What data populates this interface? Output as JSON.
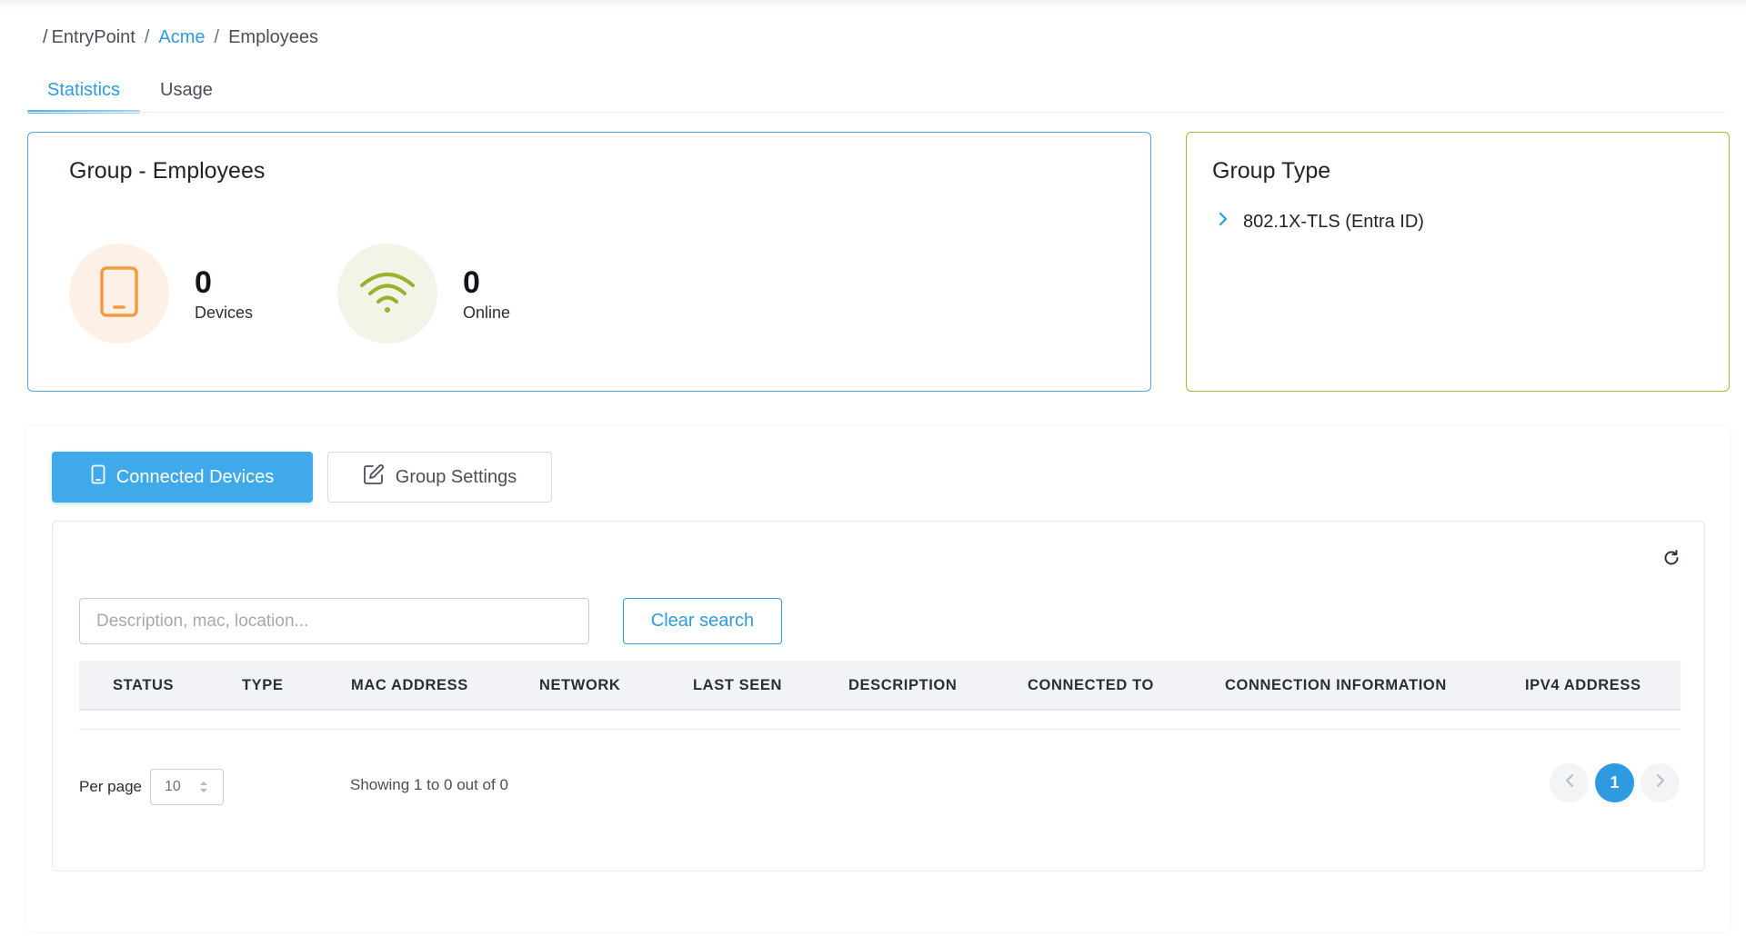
{
  "breadcrumb": {
    "root": "EntryPoint",
    "org": "Acme",
    "current": "Employees",
    "separator": "/"
  },
  "tabs": [
    {
      "label": "Statistics",
      "active": true
    },
    {
      "label": "Usage",
      "active": false
    }
  ],
  "group_card": {
    "title": "Group - Employees",
    "stats": [
      {
        "value": "0",
        "label": "Devices",
        "icon": "tablet-icon",
        "color": "#f59a3e"
      },
      {
        "value": "0",
        "label": "Online",
        "icon": "wifi-icon",
        "color": "#9cb12b"
      }
    ]
  },
  "group_type_card": {
    "title": "Group Type",
    "item": "802.1X-TLS (Entra ID)",
    "icon": "chevron-right-icon"
  },
  "panel": {
    "primary_button": "Connected Devices",
    "secondary_button": "Group Settings",
    "search": {
      "placeholder": "Description, mac, location...",
      "value": ""
    },
    "clear_button": "Clear search",
    "columns": [
      "STATUS",
      "TYPE",
      "MAC ADDRESS",
      "NETWORK",
      "LAST SEEN",
      "DESCRIPTION",
      "CONNECTED TO",
      "CONNECTION INFORMATION",
      "IPV4 ADDRESS"
    ],
    "rows": [],
    "per_page_label": "Per page",
    "per_page_value": "10",
    "showing": "Showing 1 to 0 out of 0",
    "current_page": "1"
  },
  "colors": {
    "accent": "#2e9be0",
    "group_card_border": "#4aa6e4",
    "type_card_border": "#a6b93a"
  }
}
